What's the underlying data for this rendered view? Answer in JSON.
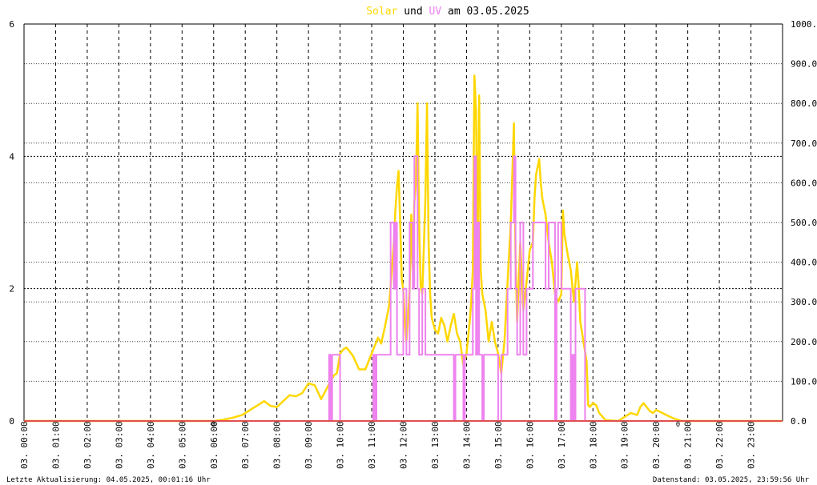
{
  "title": {
    "solar": "Solar",
    "und": "und",
    "uv": "UV",
    "date_part": "am 03.05.2025",
    "solar_color": "#ffd700",
    "uv_color": "#ee82ee"
  },
  "footer": {
    "last_update": "Letzte Aktualisierung: 04.05.2025, 00:01:16 Uhr",
    "data_status": "Datenstand: 03.05.2025, 23:59:56 Uhr"
  },
  "zero_marker": "0",
  "chart_data": {
    "type": "line",
    "grid": true,
    "x_range": [
      0,
      24
    ],
    "x_ticks": [
      "03. 00:00",
      "03. 01:00",
      "03. 02:00",
      "03. 03:00",
      "03. 04:00",
      "03. 05:00",
      "03. 06:00",
      "03. 07:00",
      "03. 08:00",
      "03. 09:00",
      "03. 10:00",
      "03. 11:00",
      "03. 12:00",
      "03. 13:00",
      "03. 14:00",
      "03. 15:00",
      "03. 16:00",
      "03. 17:00",
      "03. 18:00",
      "03. 19:00",
      "03. 20:00",
      "03. 21:00",
      "03. 22:00",
      "03. 23:00"
    ],
    "y_left": {
      "range": [
        0,
        6
      ],
      "ticks": [
        "0",
        "2",
        "4",
        "6"
      ]
    },
    "y_right": {
      "range": [
        0,
        1000
      ],
      "ticks": [
        "0.0",
        "100.0",
        "200.0",
        "300.0",
        "400.0",
        "500.0",
        "600.0",
        "700.0",
        "800.0",
        "900.0",
        "1000.0"
      ]
    },
    "series": [
      {
        "name": "Solar",
        "axis": "right",
        "color": "#ffd700",
        "points": [
          [
            0,
            0
          ],
          [
            6.0,
            0
          ],
          [
            6.3,
            3
          ],
          [
            6.6,
            8
          ],
          [
            6.9,
            15
          ],
          [
            7.2,
            30
          ],
          [
            7.4,
            40
          ],
          [
            7.6,
            50
          ],
          [
            7.8,
            38
          ],
          [
            8.0,
            35
          ],
          [
            8.2,
            50
          ],
          [
            8.4,
            65
          ],
          [
            8.6,
            62
          ],
          [
            8.8,
            70
          ],
          [
            9.0,
            95
          ],
          [
            9.2,
            90
          ],
          [
            9.4,
            55
          ],
          [
            9.6,
            85
          ],
          [
            9.8,
            115
          ],
          [
            9.9,
            120
          ],
          [
            10.0,
            170
          ],
          [
            10.1,
            180
          ],
          [
            10.2,
            185
          ],
          [
            10.4,
            165
          ],
          [
            10.6,
            130
          ],
          [
            10.8,
            130
          ],
          [
            11.0,
            170
          ],
          [
            11.1,
            190
          ],
          [
            11.2,
            210
          ],
          [
            11.3,
            195
          ],
          [
            11.4,
            230
          ],
          [
            11.5,
            270
          ],
          [
            11.55,
            290
          ],
          [
            11.6,
            340
          ],
          [
            11.7,
            450
          ],
          [
            11.75,
            530
          ],
          [
            11.8,
            590
          ],
          [
            11.85,
            630
          ],
          [
            11.9,
            500
          ],
          [
            11.95,
            360
          ],
          [
            12.0,
            330
          ],
          [
            12.05,
            250
          ],
          [
            12.1,
            200
          ],
          [
            12.2,
            330
          ],
          [
            12.25,
            520
          ],
          [
            12.3,
            380
          ],
          [
            12.35,
            550
          ],
          [
            12.4,
            600
          ],
          [
            12.45,
            800
          ],
          [
            12.5,
            500
          ],
          [
            12.55,
            340
          ],
          [
            12.6,
            320
          ],
          [
            12.7,
            560
          ],
          [
            12.75,
            800
          ],
          [
            12.8,
            450
          ],
          [
            12.85,
            320
          ],
          [
            12.9,
            260
          ],
          [
            13.0,
            230
          ],
          [
            13.1,
            220
          ],
          [
            13.2,
            260
          ],
          [
            13.3,
            240
          ],
          [
            13.4,
            200
          ],
          [
            13.5,
            240
          ],
          [
            13.6,
            270
          ],
          [
            13.7,
            220
          ],
          [
            13.8,
            200
          ],
          [
            13.9,
            140
          ],
          [
            14.0,
            170
          ],
          [
            14.1,
            250
          ],
          [
            14.15,
            300
          ],
          [
            14.2,
            380
          ],
          [
            14.25,
            870
          ],
          [
            14.3,
            780
          ],
          [
            14.35,
            400
          ],
          [
            14.4,
            820
          ],
          [
            14.45,
            380
          ],
          [
            14.5,
            320
          ],
          [
            14.55,
            300
          ],
          [
            14.6,
            280
          ],
          [
            14.7,
            200
          ],
          [
            14.8,
            250
          ],
          [
            14.9,
            200
          ],
          [
            15.0,
            170
          ],
          [
            15.1,
            120
          ],
          [
            15.2,
            200
          ],
          [
            15.3,
            350
          ],
          [
            15.4,
            500
          ],
          [
            15.45,
            620
          ],
          [
            15.5,
            750
          ],
          [
            15.55,
            420
          ],
          [
            15.6,
            250
          ],
          [
            15.7,
            450
          ],
          [
            15.8,
            280
          ],
          [
            15.9,
            350
          ],
          [
            16.0,
            430
          ],
          [
            16.1,
            450
          ],
          [
            16.15,
            560
          ],
          [
            16.2,
            620
          ],
          [
            16.3,
            660
          ],
          [
            16.35,
            600
          ],
          [
            16.4,
            560
          ],
          [
            16.5,
            520
          ],
          [
            16.6,
            450
          ],
          [
            16.7,
            400
          ],
          [
            16.8,
            320
          ],
          [
            16.9,
            300
          ],
          [
            17.0,
            320
          ],
          [
            17.05,
            530
          ],
          [
            17.1,
            470
          ],
          [
            17.2,
            420
          ],
          [
            17.3,
            380
          ],
          [
            17.4,
            300
          ],
          [
            17.5,
            400
          ],
          [
            17.55,
            340
          ],
          [
            17.6,
            250
          ],
          [
            17.7,
            200
          ],
          [
            17.8,
            150
          ],
          [
            17.85,
            40
          ],
          [
            17.9,
            35
          ],
          [
            18.0,
            45
          ],
          [
            18.1,
            40
          ],
          [
            18.2,
            20
          ],
          [
            18.4,
            2
          ],
          [
            18.8,
            0
          ],
          [
            19.0,
            10
          ],
          [
            19.2,
            20
          ],
          [
            19.4,
            15
          ],
          [
            19.5,
            35
          ],
          [
            19.6,
            45
          ],
          [
            19.7,
            35
          ],
          [
            19.8,
            25
          ],
          [
            19.9,
            20
          ],
          [
            20.0,
            28
          ],
          [
            20.2,
            20
          ],
          [
            20.4,
            12
          ],
          [
            20.6,
            5
          ],
          [
            20.8,
            0
          ],
          [
            24,
            0
          ]
        ]
      },
      {
        "name": "UV",
        "axis": "left",
        "color": "#ee82ee",
        "points": [
          [
            0,
            0
          ],
          [
            9.65,
            0
          ],
          [
            9.65,
            1
          ],
          [
            9.7,
            1
          ],
          [
            9.7,
            0
          ],
          [
            9.75,
            0
          ],
          [
            9.75,
            1
          ],
          [
            10.0,
            1
          ],
          [
            10.0,
            0
          ],
          [
            11.05,
            0
          ],
          [
            11.05,
            1
          ],
          [
            11.1,
            1
          ],
          [
            11.1,
            0
          ],
          [
            11.15,
            0
          ],
          [
            11.15,
            1
          ],
          [
            11.6,
            1
          ],
          [
            11.6,
            3
          ],
          [
            11.7,
            3
          ],
          [
            11.7,
            2
          ],
          [
            11.75,
            2
          ],
          [
            11.75,
            3
          ],
          [
            11.8,
            3
          ],
          [
            11.8,
            1
          ],
          [
            12.0,
            1
          ],
          [
            12.0,
            2
          ],
          [
            12.1,
            2
          ],
          [
            12.1,
            1
          ],
          [
            12.2,
            1
          ],
          [
            12.2,
            3
          ],
          [
            12.3,
            3
          ],
          [
            12.3,
            2
          ],
          [
            12.35,
            2
          ],
          [
            12.35,
            4
          ],
          [
            12.45,
            4
          ],
          [
            12.45,
            2
          ],
          [
            12.5,
            2
          ],
          [
            12.5,
            1
          ],
          [
            12.6,
            1
          ],
          [
            12.6,
            2
          ],
          [
            12.7,
            2
          ],
          [
            12.7,
            1
          ],
          [
            13.6,
            1
          ],
          [
            13.6,
            0
          ],
          [
            13.65,
            0
          ],
          [
            13.65,
            1
          ],
          [
            13.9,
            1
          ],
          [
            13.9,
            0
          ],
          [
            13.95,
            0
          ],
          [
            13.95,
            1
          ],
          [
            14.2,
            1
          ],
          [
            14.2,
            2
          ],
          [
            14.25,
            2
          ],
          [
            14.25,
            4
          ],
          [
            14.3,
            4
          ],
          [
            14.3,
            1
          ],
          [
            14.35,
            1
          ],
          [
            14.35,
            3
          ],
          [
            14.4,
            3
          ],
          [
            14.4,
            1
          ],
          [
            14.5,
            1
          ],
          [
            14.5,
            0
          ],
          [
            14.55,
            0
          ],
          [
            14.55,
            1
          ],
          [
            15.0,
            1
          ],
          [
            15.0,
            0
          ],
          [
            15.1,
            0
          ],
          [
            15.1,
            1
          ],
          [
            15.3,
            1
          ],
          [
            15.3,
            2
          ],
          [
            15.4,
            2
          ],
          [
            15.4,
            3
          ],
          [
            15.5,
            3
          ],
          [
            15.5,
            4
          ],
          [
            15.55,
            4
          ],
          [
            15.55,
            2
          ],
          [
            15.6,
            2
          ],
          [
            15.6,
            1
          ],
          [
            15.7,
            1
          ],
          [
            15.7,
            3
          ],
          [
            15.8,
            3
          ],
          [
            15.8,
            1
          ],
          [
            15.9,
            1
          ],
          [
            15.9,
            2
          ],
          [
            16.1,
            2
          ],
          [
            16.1,
            3
          ],
          [
            16.5,
            3
          ],
          [
            16.5,
            2
          ],
          [
            16.6,
            2
          ],
          [
            16.6,
            3
          ],
          [
            16.8,
            3
          ],
          [
            16.8,
            0
          ],
          [
            16.85,
            0
          ],
          [
            16.85,
            2
          ],
          [
            16.9,
            2
          ],
          [
            16.9,
            3
          ],
          [
            17.0,
            3
          ],
          [
            17.0,
            2
          ],
          [
            17.3,
            2
          ],
          [
            17.3,
            0
          ],
          [
            17.35,
            0
          ],
          [
            17.35,
            1
          ],
          [
            17.4,
            1
          ],
          [
            17.4,
            0
          ],
          [
            17.45,
            0
          ],
          [
            17.45,
            2
          ],
          [
            17.75,
            2
          ],
          [
            17.75,
            0
          ],
          [
            24,
            0
          ]
        ]
      }
    ]
  }
}
